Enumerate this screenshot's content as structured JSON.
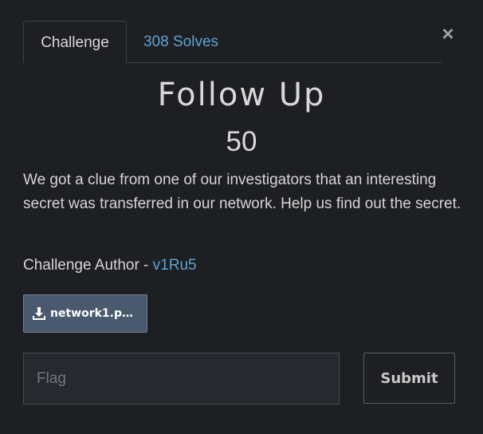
{
  "modal": {
    "close_glyph": "×",
    "tabs": [
      {
        "label": "Challenge"
      },
      {
        "label": "308 Solves"
      }
    ],
    "title": "Follow Up",
    "points": "50",
    "description": "We got a clue from one of our investigators that an interesting secret was transferred in our network. Help us find out the secret.",
    "author_prefix": "Challenge Author - ",
    "author_name": "v1Ru5",
    "file": {
      "label": "network1.pc...",
      "icon": "download-icon"
    },
    "flag_input": {
      "placeholder": "Flag",
      "value": ""
    },
    "submit_label": "Submit"
  },
  "colors": {
    "background": "#1d1f22",
    "link": "#5ea3d6",
    "file_button": "#4a5a6e"
  }
}
